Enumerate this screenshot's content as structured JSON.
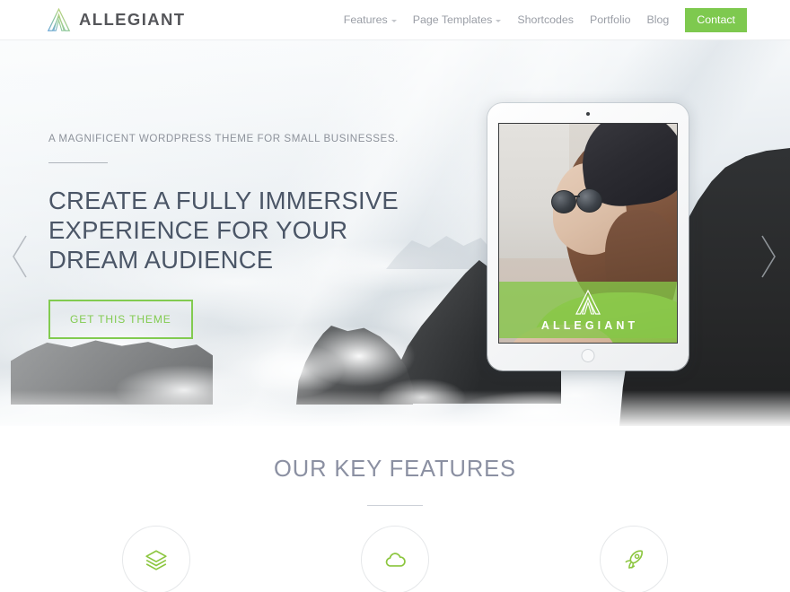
{
  "brand": {
    "name": "ALLEGIANT",
    "logo_icon": "allegiant-a-mark-icon"
  },
  "nav": {
    "items": [
      {
        "label": "Features",
        "has_dropdown": true
      },
      {
        "label": "Page Templates",
        "has_dropdown": true
      },
      {
        "label": "Shortcodes",
        "has_dropdown": false
      },
      {
        "label": "Portfolio",
        "has_dropdown": false
      },
      {
        "label": "Blog",
        "has_dropdown": false
      }
    ],
    "cta_label": "Contact",
    "cta_color": "#7ec94f",
    "link_color": "#9a9ea6"
  },
  "hero": {
    "eyebrow": "A MAGNIFICENT WORDPRESS THEME FOR SMALL BUSINESSES.",
    "title": "CREATE A FULLY IMMERSIVE EXPERIENCE FOR YOUR DREAM AUDIENCE",
    "title_color": "#4b5667",
    "cta_label": "GET THIS THEME",
    "cta_color": "#82cb50",
    "prev_icon": "chevron-left-icon",
    "next_icon": "chevron-right-icon",
    "device": {
      "band_text": "ALLEGIANT",
      "band_color": "#85c748",
      "band_logo_icon": "allegiant-a-mark-icon",
      "camera_icon": "camera-dot-icon",
      "home_icon": "home-button-icon"
    }
  },
  "features": {
    "title": "OUR KEY FEATURES",
    "title_color": "#8b90a2",
    "icon_color": "#8cc63f",
    "items": [
      {
        "icon": "layers-icon"
      },
      {
        "icon": "cloud-icon"
      },
      {
        "icon": "rocket-icon"
      }
    ]
  }
}
